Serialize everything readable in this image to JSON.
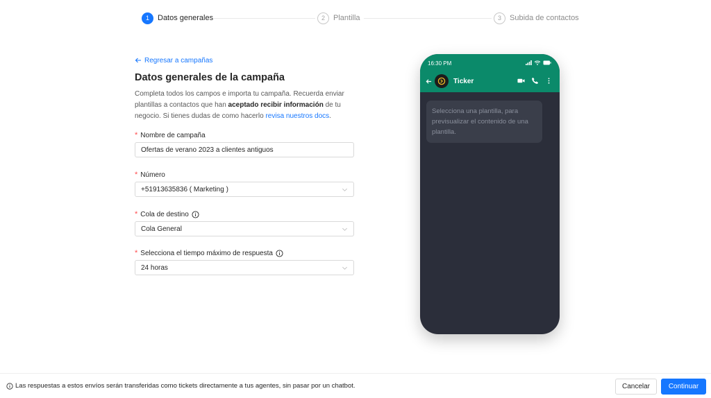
{
  "steps": [
    {
      "number": "1",
      "label": "Datos generales"
    },
    {
      "number": "2",
      "label": "Plantilla"
    },
    {
      "number": "3",
      "label": "Subida de contactos"
    }
  ],
  "form": {
    "back_link": "Regresar a campañas",
    "title": "Datos generales de la campaña",
    "desc_part1": "Completa todos los campos e importa tu campaña. Recuerda enviar plantillas a contactos que han ",
    "desc_bold": "aceptado recibir información",
    "desc_part2": " de tu negocio. Si tienes dudas de como hacerlo ",
    "desc_link": "revisa nuestros docs",
    "desc_end": ".",
    "fields": [
      {
        "label": "Nombre de campaña",
        "value": "Ofertas de verano 2023 a clientes antiguos"
      },
      {
        "label": "Número",
        "value": "+51913635836 ( Marketing )"
      },
      {
        "label": "Cola de destino",
        "value": "Cola General"
      },
      {
        "label": "Selecciona el tiempo máximo de respuesta",
        "value": "24 horas"
      }
    ]
  },
  "phone": {
    "time": "16:30 PM",
    "contact_name": "Ticker",
    "preview_text": "Selecciona una plantilla, para previsualizar el contenido de una plantilla."
  },
  "footer": {
    "note": "Las respuestas a estos envíos serán transferidas como tickets directamente a tus agentes, sin pasar por un chatbot.",
    "cancel_label": "Cancelar",
    "continue_label": "Continuar"
  },
  "colors": {
    "primary": "#1677ff",
    "whatsapp_green": "#0b8a6a",
    "chat_bg": "#2b2e3a",
    "required": "#ff4d4f"
  },
  "icons": [
    "arrow-left-icon",
    "info-icon",
    "chevron-down-icon",
    "signal-icon",
    "wifi-icon",
    "battery-icon",
    "video-icon",
    "phone-call-icon",
    "more-vertical-icon"
  ]
}
